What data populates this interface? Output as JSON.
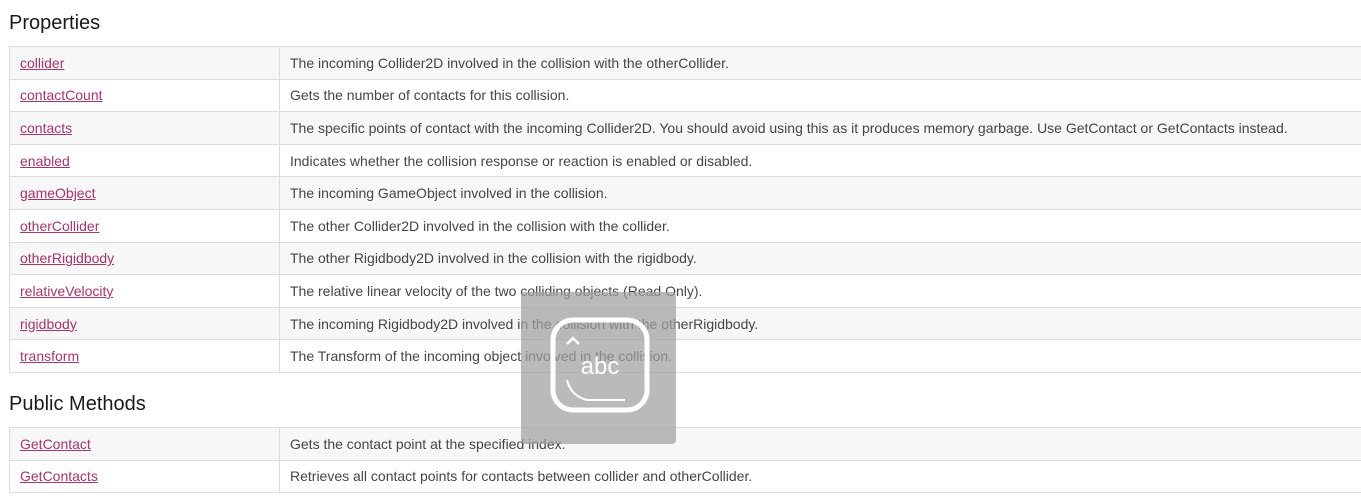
{
  "properties": {
    "heading": "Properties",
    "rows": [
      {
        "name": "collider",
        "desc": "The incoming Collider2D involved in the collision with the otherCollider."
      },
      {
        "name": "contactCount",
        "desc": "Gets the number of contacts for this collision."
      },
      {
        "name": "contacts",
        "desc": "The specific points of contact with the incoming Collider2D. You should avoid using this as it produces memory garbage. Use GetContact or GetContacts instead."
      },
      {
        "name": "enabled",
        "desc": "Indicates whether the collision response or reaction is enabled or disabled."
      },
      {
        "name": "gameObject",
        "desc": "The incoming GameObject involved in the collision."
      },
      {
        "name": "otherCollider",
        "desc": "The other Collider2D involved in the collision with the collider."
      },
      {
        "name": "otherRigidbody",
        "desc": "The other Rigidbody2D involved in the collision with the rigidbody."
      },
      {
        "name": "relativeVelocity",
        "desc": "The relative linear velocity of the two colliding objects (Read Only)."
      },
      {
        "name": "rigidbody",
        "desc": "The incoming Rigidbody2D involved in the collision with the otherRigidbody."
      },
      {
        "name": "transform",
        "desc": "The Transform of the incoming object involved in the collision."
      }
    ]
  },
  "public_methods": {
    "heading": "Public Methods",
    "rows": [
      {
        "name": "GetContact",
        "desc": "Gets the contact point at the specified index."
      },
      {
        "name": "GetContacts",
        "desc": "Retrieves all contact points for contacts between collider and otherCollider."
      }
    ]
  },
  "overlay": {
    "icon": "keyboard-input-icon",
    "text": "abc"
  },
  "colors": {
    "link": "#a5356b",
    "text": "#454545",
    "row_alt": "#f7f7f7",
    "border": "#dcdcdc"
  }
}
